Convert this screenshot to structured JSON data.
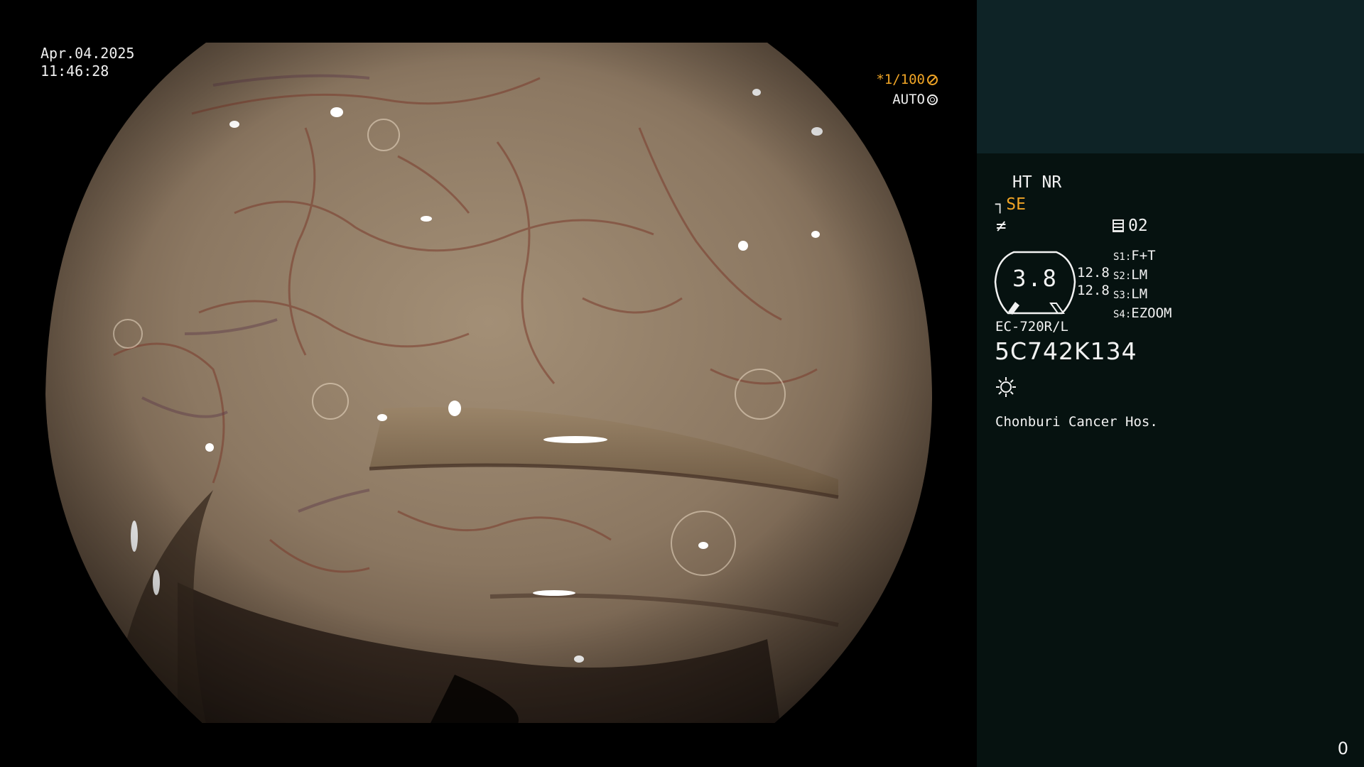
{
  "overlay": {
    "date": "Apr.04.2025",
    "time": "11:46:28",
    "shutter": "*1/100",
    "shutter_icon": "aperture-icon",
    "iris_mode": "AUTO",
    "iris_icon": "iris-icon"
  },
  "panel": {
    "enhance": "HT NR",
    "structure_icon": "structure-enhance-icon",
    "structure_mode": "SE",
    "filter_icon": "f-icon",
    "memory_icon": "memory-icon",
    "memory_value": "02",
    "gauge_value": "3.8",
    "value_a": "12.8",
    "value_b": "12.8",
    "switches": [
      {
        "key": "S1",
        "value": "F+T"
      },
      {
        "key": "S2",
        "value": "LM"
      },
      {
        "key": "S3",
        "value": "LM"
      },
      {
        "key": "S4",
        "value": "EZOOM"
      }
    ],
    "scope_model": "EC-720R/L",
    "serial_number": "5C742K134",
    "light_icon": "light-source-icon",
    "hospital": "Chonburi Cancer Hos.",
    "counter": "0"
  },
  "colors": {
    "accent": "#f0a526",
    "panel_bg": "#061210",
    "thumb_bg": "#0e2326",
    "tissue": "#8a7660"
  }
}
